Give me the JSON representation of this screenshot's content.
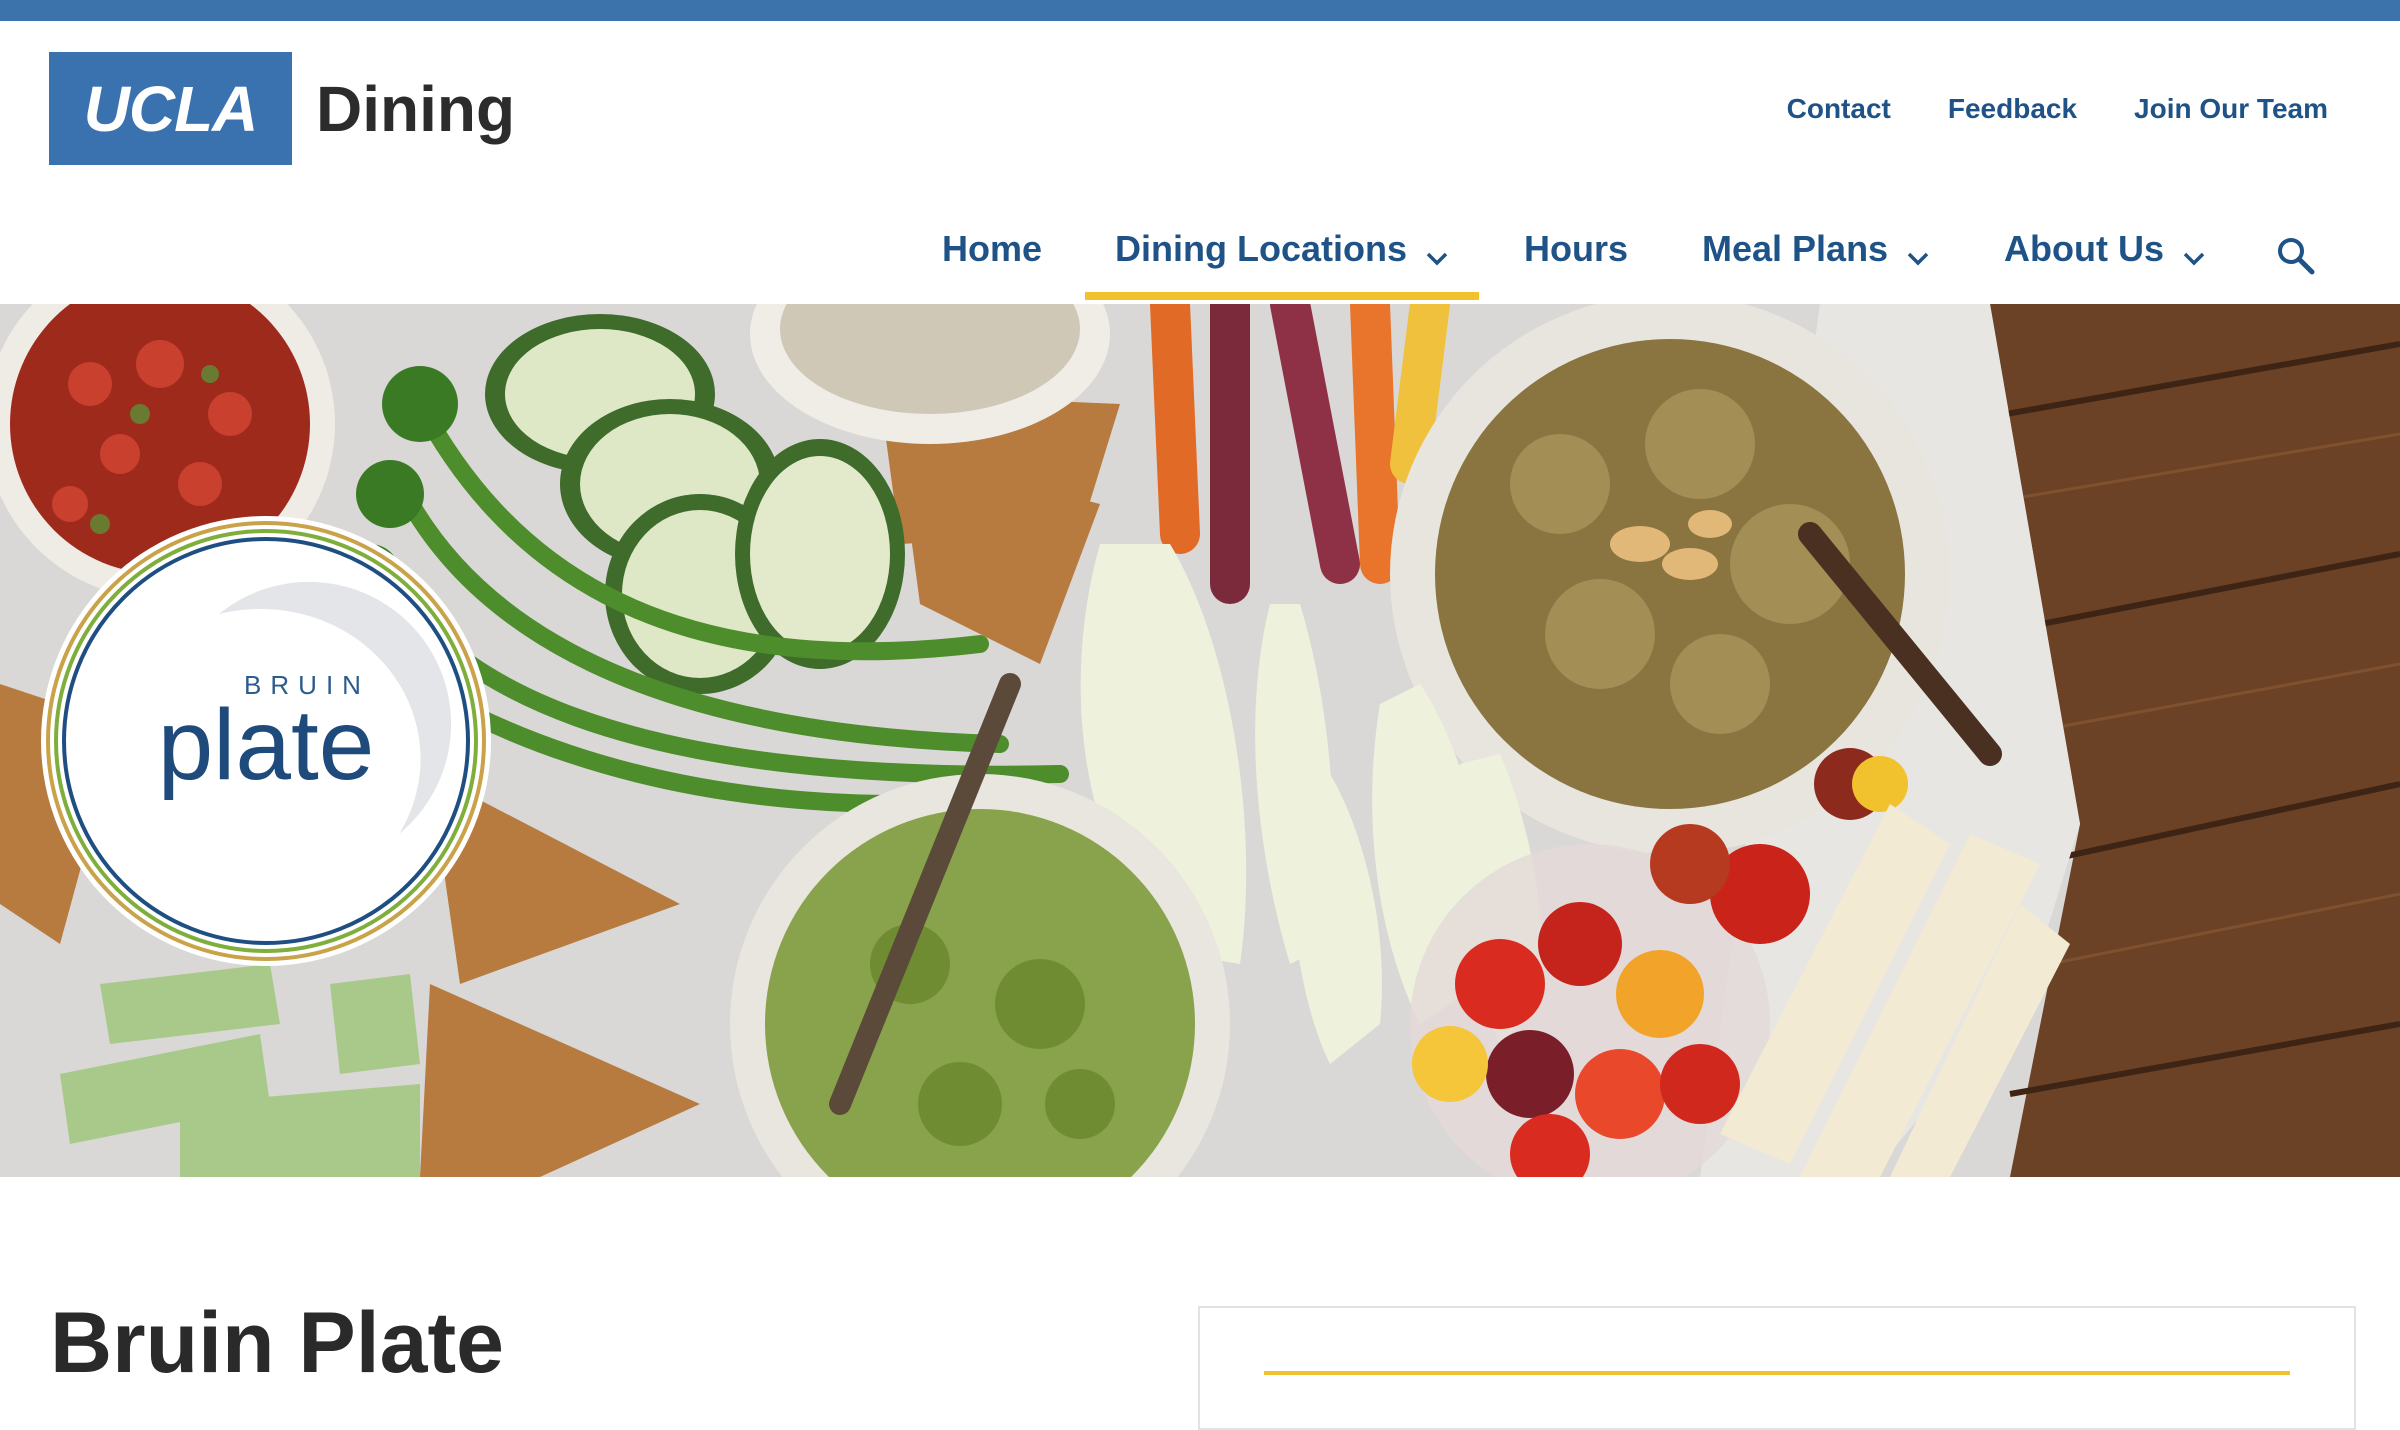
{
  "logo": {
    "mark": "UCLA",
    "name": "Dining"
  },
  "utility_nav": [
    "Contact",
    "Feedback",
    "Join Our Team"
  ],
  "main_nav": {
    "items": [
      {
        "label": "Home",
        "has_dropdown": false
      },
      {
        "label": "Dining Locations",
        "has_dropdown": true,
        "active": true
      },
      {
        "label": "Hours",
        "has_dropdown": false
      },
      {
        "label": "Meal Plans",
        "has_dropdown": true
      },
      {
        "label": "About Us",
        "has_dropdown": true
      }
    ],
    "search_icon": "search-icon"
  },
  "hero": {
    "badge": {
      "top": "BRUIN",
      "word": "plate"
    }
  },
  "page": {
    "title": "Bruin Plate"
  },
  "colors": {
    "brand_blue": "#3a72b0",
    "link_blue": "#1f5387",
    "accent_gold": "#f2c12e",
    "text_dark": "#2a2a2a"
  }
}
